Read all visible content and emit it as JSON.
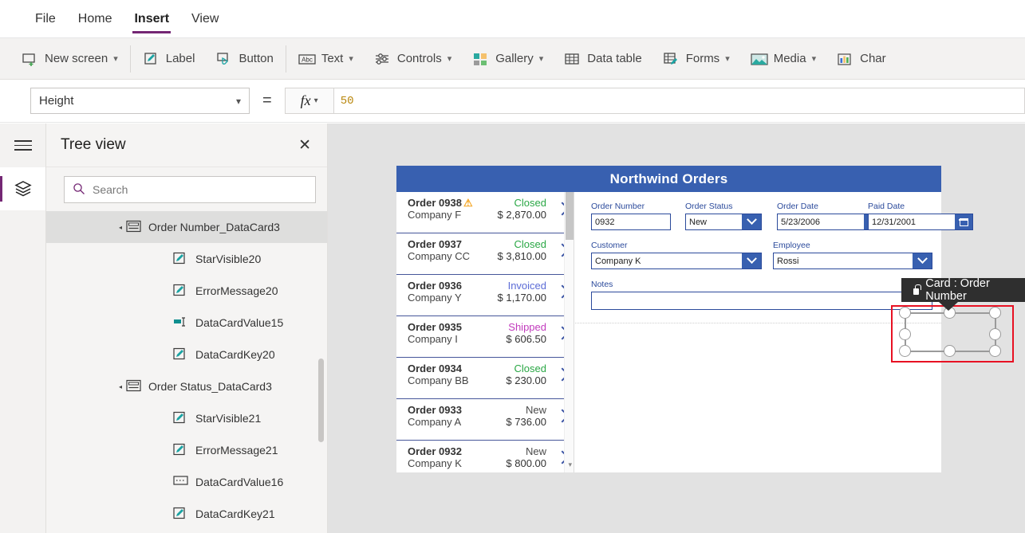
{
  "menu": {
    "items": [
      {
        "label": "File",
        "active": false
      },
      {
        "label": "Home",
        "active": false
      },
      {
        "label": "Insert",
        "active": true
      },
      {
        "label": "View",
        "active": false
      }
    ]
  },
  "ribbon": {
    "items": [
      {
        "label": "New screen",
        "icon": "new-screen-icon",
        "chevron": true
      },
      {
        "label": "Label",
        "icon": "label-icon",
        "chevron": false
      },
      {
        "label": "Button",
        "icon": "button-icon",
        "chevron": false
      },
      {
        "label": "Text",
        "icon": "text-abc-icon",
        "chevron": true
      },
      {
        "label": "Controls",
        "icon": "controls-sliders-icon",
        "chevron": true
      },
      {
        "label": "Gallery",
        "icon": "gallery-grid-icon",
        "chevron": true
      },
      {
        "label": "Data table",
        "icon": "data-table-icon",
        "chevron": false
      },
      {
        "label": "Forms",
        "icon": "forms-icon",
        "chevron": true
      },
      {
        "label": "Media",
        "icon": "media-image-icon",
        "chevron": true
      },
      {
        "label": "Char",
        "icon": "chart-bars-icon",
        "chevron": false
      }
    ]
  },
  "propertybar": {
    "property": "Height",
    "equals": "=",
    "fx_label": "fx",
    "formula": "50"
  },
  "treeview": {
    "title": "Tree view",
    "close_label": "✕",
    "search": {
      "placeholder": "Search",
      "value": ""
    },
    "nodes": [
      {
        "label": "Order Number_DataCard3",
        "level": 1,
        "icon": "datacard-icon",
        "caret": "◂",
        "selected": true
      },
      {
        "label": "StarVisible20",
        "level": 2,
        "icon": "label-pencil-icon",
        "caret": "",
        "selected": false
      },
      {
        "label": "ErrorMessage20",
        "level": 2,
        "icon": "label-pencil-icon",
        "caret": "",
        "selected": false
      },
      {
        "label": "DataCardValue15",
        "level": 2,
        "icon": "textinput-icon",
        "caret": "",
        "selected": false
      },
      {
        "label": "DataCardKey20",
        "level": 2,
        "icon": "label-pencil-icon",
        "caret": "",
        "selected": false
      },
      {
        "label": "Order Status_DataCard3",
        "level": 1,
        "icon": "datacard-icon",
        "caret": "◂",
        "selected": false
      },
      {
        "label": "StarVisible21",
        "level": 2,
        "icon": "label-pencil-icon",
        "caret": "",
        "selected": false
      },
      {
        "label": "ErrorMessage21",
        "level": 2,
        "icon": "label-pencil-icon",
        "caret": "",
        "selected": false
      },
      {
        "label": "DataCardValue16",
        "level": 2,
        "icon": "dropdown-icon",
        "caret": "",
        "selected": false
      },
      {
        "label": "DataCardKey21",
        "level": 2,
        "icon": "label-pencil-icon",
        "caret": "",
        "selected": false
      }
    ]
  },
  "tooltip": {
    "text": "Card : Order Number",
    "icon": "lock-icon"
  },
  "screen": {
    "app_title": "Northwind Orders",
    "header_color": "#3860b0",
    "gallery": {
      "items": [
        {
          "order": "Order 0938",
          "company": "Company F",
          "status": "Closed",
          "status_color": "#2aa745",
          "amount": "$ 2,870.00",
          "warning": true
        },
        {
          "order": "Order 0937",
          "company": "Company CC",
          "status": "Closed",
          "status_color": "#2aa745",
          "amount": "$ 3,810.00",
          "warning": false
        },
        {
          "order": "Order 0936",
          "company": "Company Y",
          "status": "Invoiced",
          "status_color": "#5b6bd6",
          "amount": "$ 1,170.00",
          "warning": false
        },
        {
          "order": "Order 0935",
          "company": "Company I",
          "status": "Shipped",
          "status_color": "#c23bbd",
          "amount": "$ 606.50",
          "warning": false
        },
        {
          "order": "Order 0934",
          "company": "Company BB",
          "status": "Closed",
          "status_color": "#2aa745",
          "amount": "$ 230.00",
          "warning": false
        },
        {
          "order": "Order 0933",
          "company": "Company A",
          "status": "New",
          "status_color": "#4a4a4a",
          "amount": "$ 736.00",
          "warning": false
        },
        {
          "order": "Order 0932",
          "company": "Company K",
          "status": "New",
          "status_color": "#4a4a4a",
          "amount": "$ 800.00",
          "warning": false
        }
      ]
    },
    "form": {
      "order_number": {
        "label": "Order Number",
        "value": "0932"
      },
      "order_status": {
        "label": "Order Status",
        "value": "New"
      },
      "order_date": {
        "label": "Order Date",
        "value": "5/23/2006"
      },
      "paid_date": {
        "label": "Paid Date",
        "value": "12/31/2001"
      },
      "customer": {
        "label": "Customer",
        "value": "Company K"
      },
      "employee": {
        "label": "Employee",
        "value": "Rossi"
      },
      "notes": {
        "label": "Notes",
        "value": ""
      }
    }
  }
}
